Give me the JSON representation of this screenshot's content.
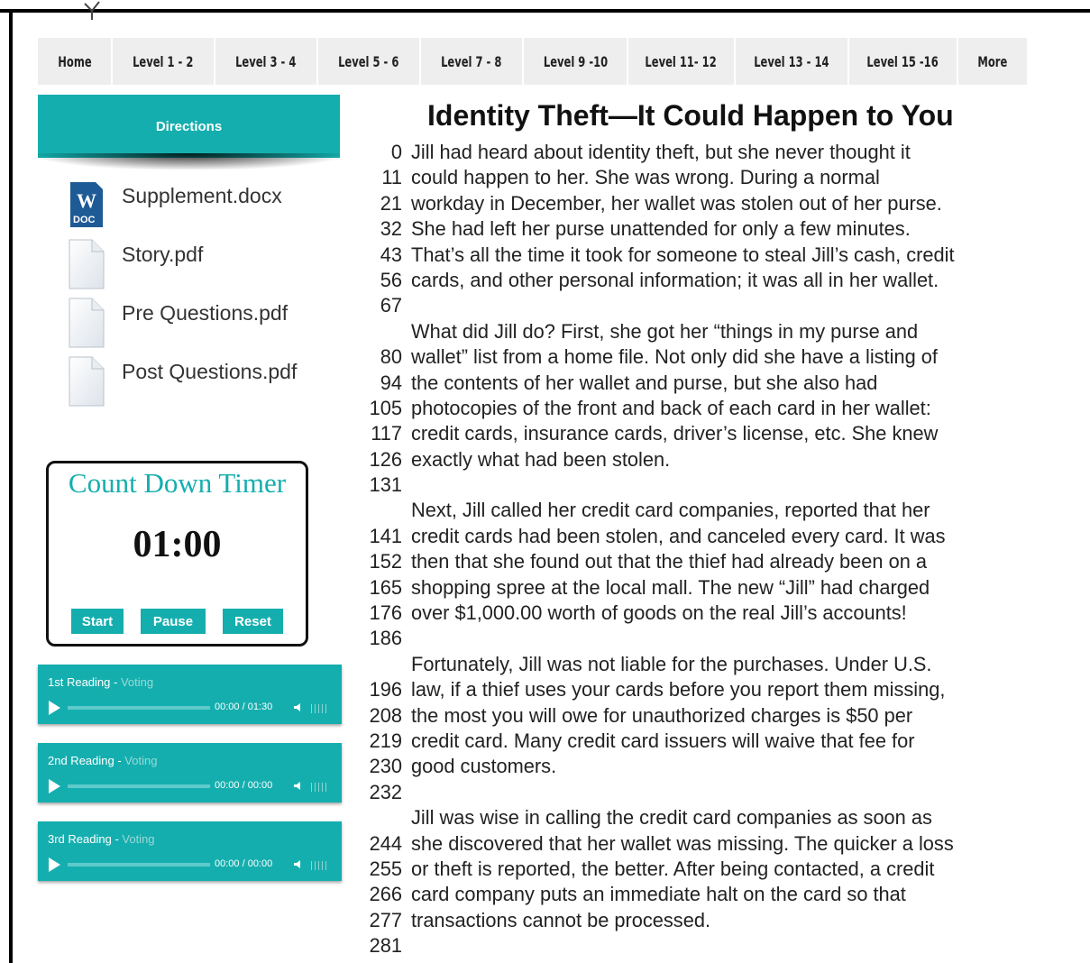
{
  "nav": {
    "items": [
      "Home",
      "Level 1 - 2",
      "Level 3 - 4",
      "Level 5 - 6",
      "Level 7 - 8",
      "Level 9 -10",
      "Level 11- 12",
      "Level 13 - 14",
      "Level 15 -16",
      "More"
    ]
  },
  "sidebar": {
    "directions_label": "Directions",
    "files": [
      {
        "name": "Supplement.docx",
        "icon": "word-doc-icon",
        "badge": "DOC"
      },
      {
        "name": "Story.pdf",
        "icon": "file-icon"
      },
      {
        "name": "Pre Questions.pdf",
        "icon": "file-icon"
      },
      {
        "name": "Post Questions.pdf",
        "icon": "file-icon"
      }
    ]
  },
  "timer": {
    "title": "Count Down Timer",
    "value": "01:00",
    "start_label": "Start",
    "pause_label": "Pause",
    "reset_label": "Reset"
  },
  "players": [
    {
      "title": "1st Reading",
      "separator": " - ",
      "vote": "Voting",
      "time": "00:00 / 01:30"
    },
    {
      "title": "2nd Reading",
      "separator": " - ",
      "vote": "Voting",
      "time": "00:00 / 00:00"
    },
    {
      "title": "3rd Reading",
      "separator": " - ",
      "vote": "Voting",
      "time": "00:00 / 00:00"
    }
  ],
  "story": {
    "title": "Identity Theft—It Could Happen to You",
    "lines": [
      {
        "n": "0",
        "t": "Jill had heard about identity theft, but she never thought it"
      },
      {
        "n": "11",
        "t": "could happen to her. She was wrong. During a normal"
      },
      {
        "n": "21",
        "t": "workday in December, her wallet was stolen out of her purse."
      },
      {
        "n": "32",
        "t": "She had left her purse unattended for only a few minutes."
      },
      {
        "n": "43",
        "t": "That’s all the time it took for someone to steal Jill’s cash, credit"
      },
      {
        "n": "56",
        "t": "cards, and other personal information; it was all in her wallet."
      },
      {
        "n": "67",
        "t": ""
      },
      {
        "n": "",
        "t": "What did Jill do? First, she got her “things in my purse and"
      },
      {
        "n": "80",
        "t": "wallet” list from a home file. Not only did she have a listing of"
      },
      {
        "n": "94",
        "t": "the contents of her wallet and purse, but she also had"
      },
      {
        "n": "105",
        "t": "photocopies of the front and back of each card in her wallet:"
      },
      {
        "n": "117",
        "t": "credit cards, insurance cards, driver’s license, etc. She knew"
      },
      {
        "n": "126",
        "t": "exactly what had been stolen."
      },
      {
        "n": "131",
        "t": ""
      },
      {
        "n": "",
        "t": "Next, Jill called her credit card companies, reported that her"
      },
      {
        "n": "141",
        "t": "credit cards had been stolen, and canceled every card. It was"
      },
      {
        "n": "152",
        "t": "then that she found out that the thief had already been on a"
      },
      {
        "n": "165",
        "t": "shopping spree at the local mall. The new “Jill” had charged"
      },
      {
        "n": "176",
        "t": "over $1,000.00 worth of goods on the real Jill’s accounts!"
      },
      {
        "n": "186",
        "t": ""
      },
      {
        "n": "",
        "t": "Fortunately, Jill was not liable for the purchases. Under U.S."
      },
      {
        "n": "196",
        "t": "law, if a thief uses your cards before you report them missing,"
      },
      {
        "n": "208",
        "t": "the most you will owe for unauthorized charges is $50 per"
      },
      {
        "n": "219",
        "t": "credit card. Many credit card issuers will waive that fee for"
      },
      {
        "n": "230",
        "t": "good customers."
      },
      {
        "n": "232",
        "t": ""
      },
      {
        "n": "",
        "t": "Jill was wise in calling the credit card companies as soon as"
      },
      {
        "n": "244",
        "t": "she discovered that her wallet was missing. The quicker a loss"
      },
      {
        "n": "255",
        "t": "or theft is reported, the better. After being contacted, a credit"
      },
      {
        "n": "266",
        "t": "card company puts an immediate halt on the card so that"
      },
      {
        "n": "277",
        "t": "transactions cannot be processed."
      },
      {
        "n": "281",
        "t": ""
      }
    ]
  },
  "colors": {
    "accent": "#15aeae",
    "nav_bg": "#eeeeee",
    "text": "#222222"
  }
}
